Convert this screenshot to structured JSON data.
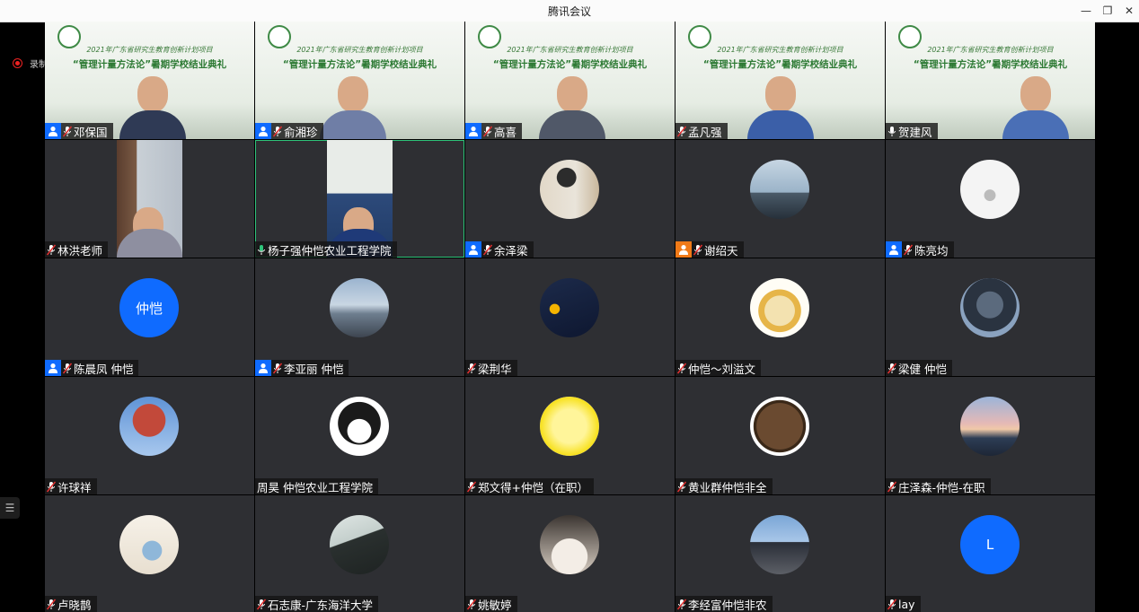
{
  "window": {
    "title": "腾讯会议"
  },
  "recording": {
    "label": "录制中"
  },
  "banner": {
    "line1": "2021年广东省研究生教育创新计划项目",
    "line2": "“管理计量方法论”暑期学校结业典礼"
  },
  "participants": [
    {
      "name": "邓保国",
      "type": "banner",
      "person_icon": true,
      "mic": "muted"
    },
    {
      "name": "俞湘珍",
      "type": "banner",
      "person_icon": true,
      "mic": "muted"
    },
    {
      "name": "高喜",
      "type": "banner",
      "person_icon": true,
      "mic": "muted"
    },
    {
      "name": "孟凡强",
      "type": "banner",
      "person_icon": false,
      "mic": "muted"
    },
    {
      "name": "贺建风",
      "type": "banner",
      "person_icon": false,
      "mic": "on"
    },
    {
      "name": "林洪老师",
      "type": "video",
      "person_icon": false,
      "mic": "muted"
    },
    {
      "name": "杨子强仲恺农业工程学院",
      "type": "video",
      "person_icon": false,
      "mic": "active",
      "active": true
    },
    {
      "name": "余泽梁",
      "type": "avatar",
      "person_icon": true,
      "mic": "muted",
      "avatar": "photo-person-wall"
    },
    {
      "name": "谢绍天",
      "type": "avatar",
      "person_icon": true,
      "person_icon_color": "orange",
      "mic": "muted",
      "avatar": "photo-person-sea"
    },
    {
      "name": "陈亮均",
      "type": "avatar",
      "person_icon": true,
      "mic": "muted",
      "avatar": "sketch-drawing"
    },
    {
      "name": "陈晨凤 仲恺",
      "type": "avatar",
      "person_icon": true,
      "mic": "muted",
      "avatar": "text",
      "avatar_text": "仲恺"
    },
    {
      "name": "李亚丽 仲恺",
      "type": "avatar",
      "person_icon": true,
      "mic": "muted",
      "avatar": "photo-sky"
    },
    {
      "name": "梁荆华",
      "type": "avatar",
      "person_icon": false,
      "mic": "muted",
      "avatar": "dark-sunflower"
    },
    {
      "name": "仲恺～刘溢文",
      "type": "avatar",
      "person_icon": false,
      "mic": "muted",
      "avatar": "lion-cartoon"
    },
    {
      "name": "梁健 仲恺",
      "type": "avatar",
      "person_icon": false,
      "mic": "muted",
      "avatar": "pilot-helmet"
    },
    {
      "name": "许球祥",
      "type": "avatar",
      "person_icon": false,
      "mic": "muted",
      "avatar": "red-tree"
    },
    {
      "name": "周昊 仲恺农业工程学院",
      "type": "avatar",
      "person_icon": false,
      "mic": "none",
      "avatar": "anime-cat"
    },
    {
      "name": "郑文得+仲恺（在职）",
      "type": "avatar",
      "person_icon": false,
      "mic": "muted",
      "avatar": "yellow-circle"
    },
    {
      "name": "黄业群仲恺非全",
      "type": "avatar",
      "person_icon": false,
      "mic": "muted",
      "avatar": "bronze-plate"
    },
    {
      "name": "庄泽森-仲恺-在职",
      "type": "avatar",
      "person_icon": false,
      "mic": "muted",
      "avatar": "sunset-sky"
    },
    {
      "name": "卢晓鹊",
      "type": "avatar",
      "person_icon": false,
      "mic": "muted",
      "avatar": "cartoon-figure"
    },
    {
      "name": "石志康-广东海洋大学",
      "type": "avatar",
      "person_icon": false,
      "mic": "muted",
      "avatar": "white-cup"
    },
    {
      "name": "姚敏婷",
      "type": "avatar",
      "person_icon": false,
      "mic": "muted",
      "avatar": "white-cat"
    },
    {
      "name": "李经富仲恺非农",
      "type": "avatar",
      "person_icon": false,
      "mic": "muted",
      "avatar": "chinese-building"
    },
    {
      "name": "lay",
      "type": "avatar",
      "person_icon": false,
      "mic": "muted",
      "avatar": "text",
      "avatar_text": "L"
    }
  ],
  "colors": {
    "tile_bg": "#2e2f33",
    "person_icon": "#0f6bff",
    "active_border": "#2ec47a",
    "muted_mic": "#e03030"
  }
}
